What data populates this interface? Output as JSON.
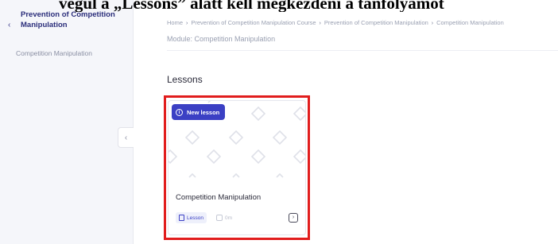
{
  "overlay_caption": "végül a „Lessons” alatt kell megkezdeni a tanfolyamot",
  "sidebar": {
    "back_icon": "chevron-left-icon",
    "back_glyph": "‹",
    "course_title": "Prevention of Competition Manipulation",
    "module_link": "Competition Manipulation",
    "collapse_glyph": "‹"
  },
  "breadcrumb": {
    "items": [
      "Home",
      "Prevention of Competition Manipulation Course",
      "Prevention of Competition Manipulation",
      "Competition Manipulation"
    ],
    "separator": "›"
  },
  "module_line": "Module: Competition Manipulation",
  "lessons_heading": "Lessons",
  "lesson_card": {
    "badge_label": "New lesson",
    "badge_icon_glyph": "i",
    "title": "Competition Manipulation",
    "type_label": "Lesson",
    "duration": "0m",
    "action_glyph": "›",
    "highlight_color": "#e11d1d",
    "accent_color": "#3b40c4"
  }
}
